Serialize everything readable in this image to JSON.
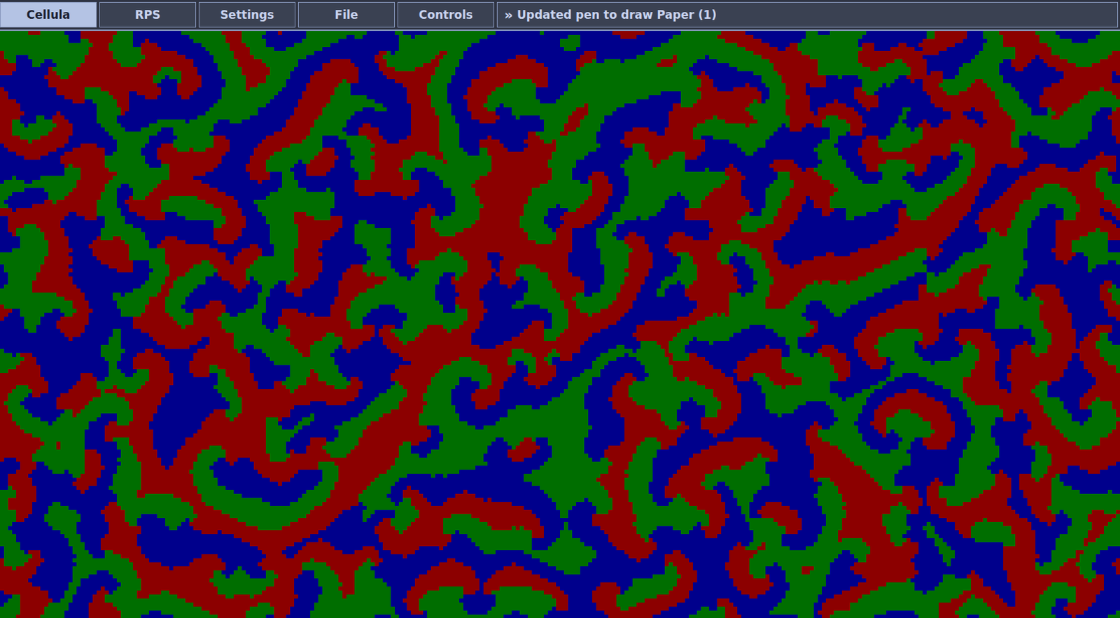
{
  "menu": [
    {
      "label": "Cellula",
      "selected": true
    },
    {
      "label": "RPS",
      "selected": false
    },
    {
      "label": "Settings",
      "selected": false
    },
    {
      "label": "File",
      "selected": false
    },
    {
      "label": "Controls",
      "selected": false
    }
  ],
  "status": {
    "icon": "»",
    "text": "Updated pen to draw Paper (1)"
  },
  "canvas": {
    "palette": [
      "#8c0000",
      "#006e00",
      "#00008c"
    ]
  }
}
